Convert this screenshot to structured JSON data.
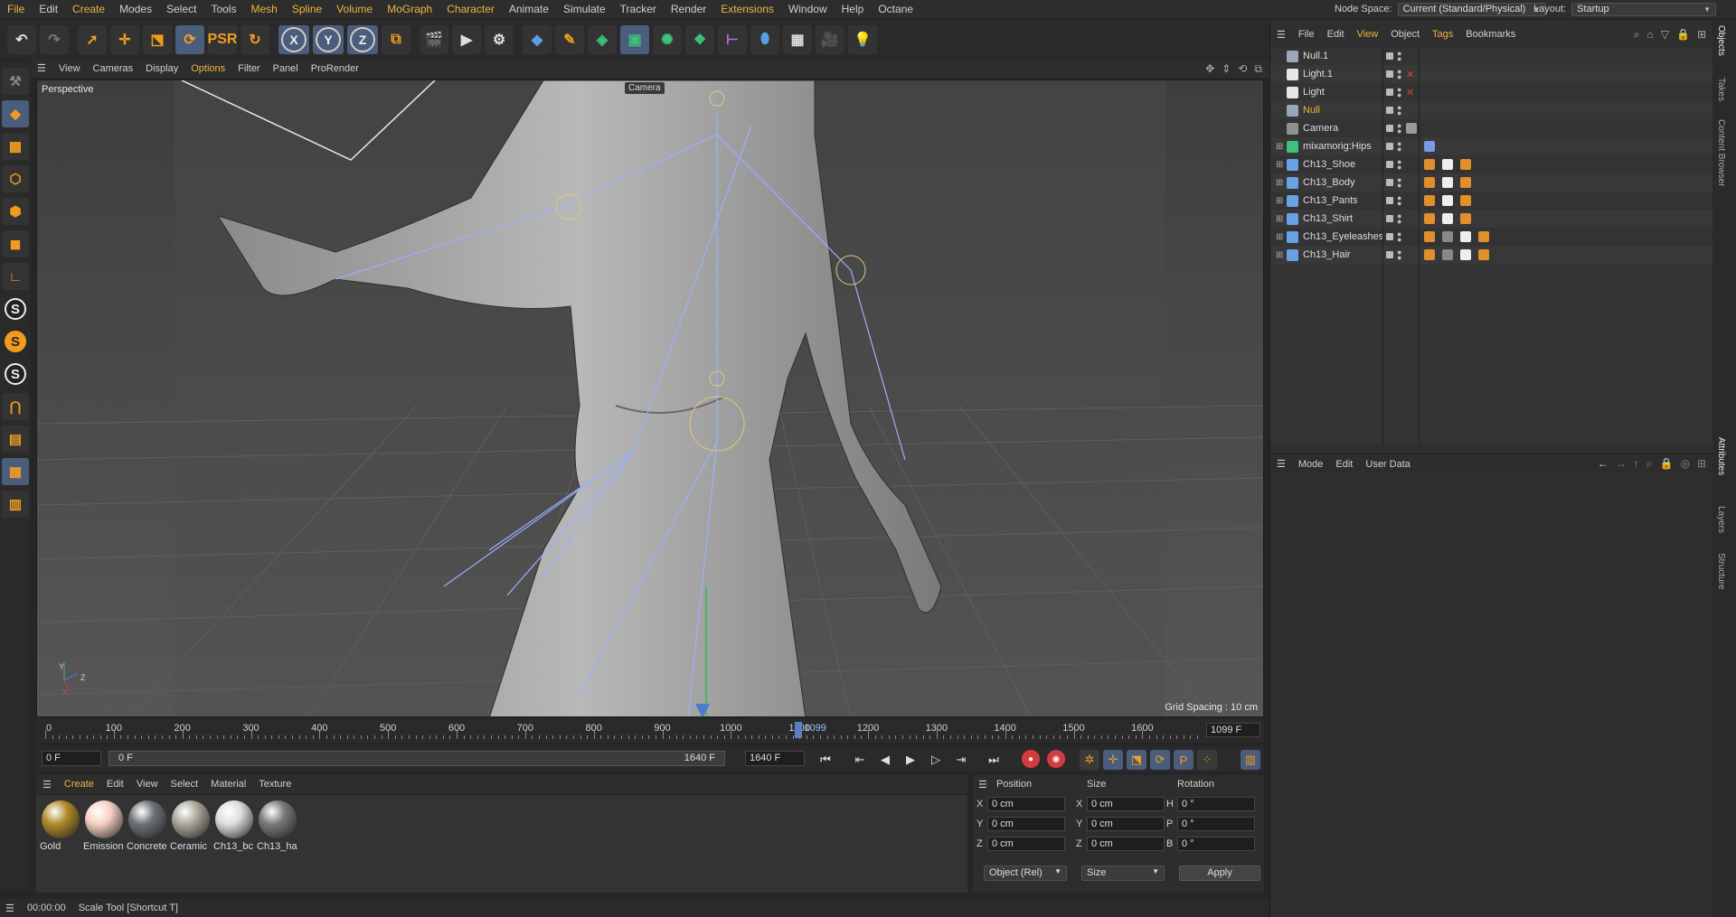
{
  "menubar": {
    "items": [
      {
        "label": "File",
        "accent": true
      },
      {
        "label": "Edit"
      },
      {
        "label": "Create",
        "accent": true
      },
      {
        "label": "Modes"
      },
      {
        "label": "Select"
      },
      {
        "label": "Tools"
      },
      {
        "label": "Mesh",
        "accent": true
      },
      {
        "label": "Spline",
        "accent": true
      },
      {
        "label": "Volume",
        "accent": true
      },
      {
        "label": "MoGraph",
        "accent": true
      },
      {
        "label": "Character",
        "accent": true
      },
      {
        "label": "Animate"
      },
      {
        "label": "Simulate"
      },
      {
        "label": "Tracker"
      },
      {
        "label": "Render"
      },
      {
        "label": "Extensions",
        "accent": true
      },
      {
        "label": "Window"
      },
      {
        "label": "Help"
      },
      {
        "label": "Octane"
      }
    ],
    "node_space_label": "Node Space:",
    "node_space_value": "Current (Standard/Physical)",
    "layout_label": "Layout:",
    "layout_value": "Startup"
  },
  "viewport": {
    "menu": [
      {
        "label": "View"
      },
      {
        "label": "Cameras"
      },
      {
        "label": "Display"
      },
      {
        "label": "Options",
        "accent": true
      },
      {
        "label": "Filter"
      },
      {
        "label": "Panel"
      },
      {
        "label": "ProRender"
      }
    ],
    "label": "Perspective",
    "camera_tag": "Camera",
    "grid_spacing": "Grid Spacing : 10 cm",
    "axis_y": "Y",
    "axis_z": "Z",
    "axis_x": "X"
  },
  "timeline": {
    "ticks": [
      "0",
      "100",
      "200",
      "300",
      "400",
      "500",
      "600",
      "700",
      "800",
      "900",
      "1000",
      "1100",
      "1200",
      "1300",
      "1400",
      "1500",
      "1600"
    ],
    "playhead_label": "1099",
    "playhead_value": 1099,
    "end_frame": "1099 F",
    "current_frame": "0 F",
    "range_start": "0 F",
    "range_end": "1640 F",
    "max_frame": "1640 F"
  },
  "materials": {
    "menu": [
      {
        "label": "Create",
        "accent": true
      },
      {
        "label": "Edit"
      },
      {
        "label": "View"
      },
      {
        "label": "Select"
      },
      {
        "label": "Material"
      },
      {
        "label": "Texture"
      }
    ],
    "items": [
      {
        "name": "Gold",
        "color": "#b08a2a"
      },
      {
        "name": "Emission",
        "color": "#f6d0c4"
      },
      {
        "name": "Concrete",
        "color": "#6f7275"
      },
      {
        "name": "Ceramic",
        "color": "#aaa89a"
      },
      {
        "name": "Ch13_bc",
        "color": "#dddddd"
      },
      {
        "name": "Ch13_ha",
        "color": "#7a7a7a"
      }
    ]
  },
  "coordinates": {
    "headers": [
      "Position",
      "Size",
      "Rotation"
    ],
    "rows": [
      {
        "a": "X",
        "pos": "0 cm",
        "b": "X",
        "size": "0 cm",
        "c": "H",
        "rot": "0 °"
      },
      {
        "a": "Y",
        "pos": "0 cm",
        "b": "Y",
        "size": "0 cm",
        "c": "P",
        "rot": "0 °"
      },
      {
        "a": "Z",
        "pos": "0 cm",
        "b": "Z",
        "size": "0 cm",
        "c": "B",
        "rot": "0 °"
      }
    ],
    "mode_dropdown": "Object (Rel)",
    "size_dropdown": "Size",
    "apply_label": "Apply"
  },
  "statusbar": {
    "time": "00:00:00",
    "message": "Scale Tool [Shortcut T]"
  },
  "object_manager": {
    "menu": [
      {
        "label": "File"
      },
      {
        "label": "Edit"
      },
      {
        "label": "View",
        "accent": true
      },
      {
        "label": "Object"
      },
      {
        "label": "Tags",
        "accent": true
      },
      {
        "label": "Bookmarks"
      }
    ],
    "objects": [
      {
        "name": "Null.1",
        "icon_color": "#9aa7b8",
        "expand": "",
        "xmark": false
      },
      {
        "name": "Light.1",
        "icon_color": "#e6e6e6",
        "expand": "",
        "xmark": true
      },
      {
        "name": "Light",
        "icon_color": "#e6e6e6",
        "expand": "",
        "xmark": true
      },
      {
        "name": "Null",
        "icon_color": "#9aa7b8",
        "expand": "",
        "xmark": false,
        "accent": true
      },
      {
        "name": "Camera",
        "icon_color": "#8f8f8f",
        "expand": "",
        "xmark": false
      },
      {
        "name": "mixamorig:Hips",
        "icon_color": "#3cc27a",
        "expand": "⊞",
        "xmark": false
      },
      {
        "name": "Ch13_Shoe",
        "icon_color": "#6aa0e6",
        "expand": "⊞",
        "xmark": false
      },
      {
        "name": "Ch13_Body",
        "icon_color": "#6aa0e6",
        "expand": "⊞",
        "xmark": false
      },
      {
        "name": "Ch13_Pants",
        "icon_color": "#6aa0e6",
        "expand": "⊞",
        "xmark": false
      },
      {
        "name": "Ch13_Shirt",
        "icon_color": "#6aa0e6",
        "expand": "⊞",
        "xmark": false
      },
      {
        "name": "Ch13_Eyeleashes",
        "icon_color": "#6aa0e6",
        "expand": "⊞",
        "xmark": false
      },
      {
        "name": "Ch13_Hair",
        "icon_color": "#6aa0e6",
        "expand": "⊞",
        "xmark": false
      }
    ]
  },
  "attributes": {
    "menu": [
      {
        "label": "Mode"
      },
      {
        "label": "Edit"
      },
      {
        "label": "User Data"
      }
    ]
  },
  "side_tabs": {
    "top": [
      "Objects",
      "Takes",
      "Content Browser"
    ],
    "bottom": [
      "Attributes",
      "Layers",
      "Structure"
    ]
  }
}
